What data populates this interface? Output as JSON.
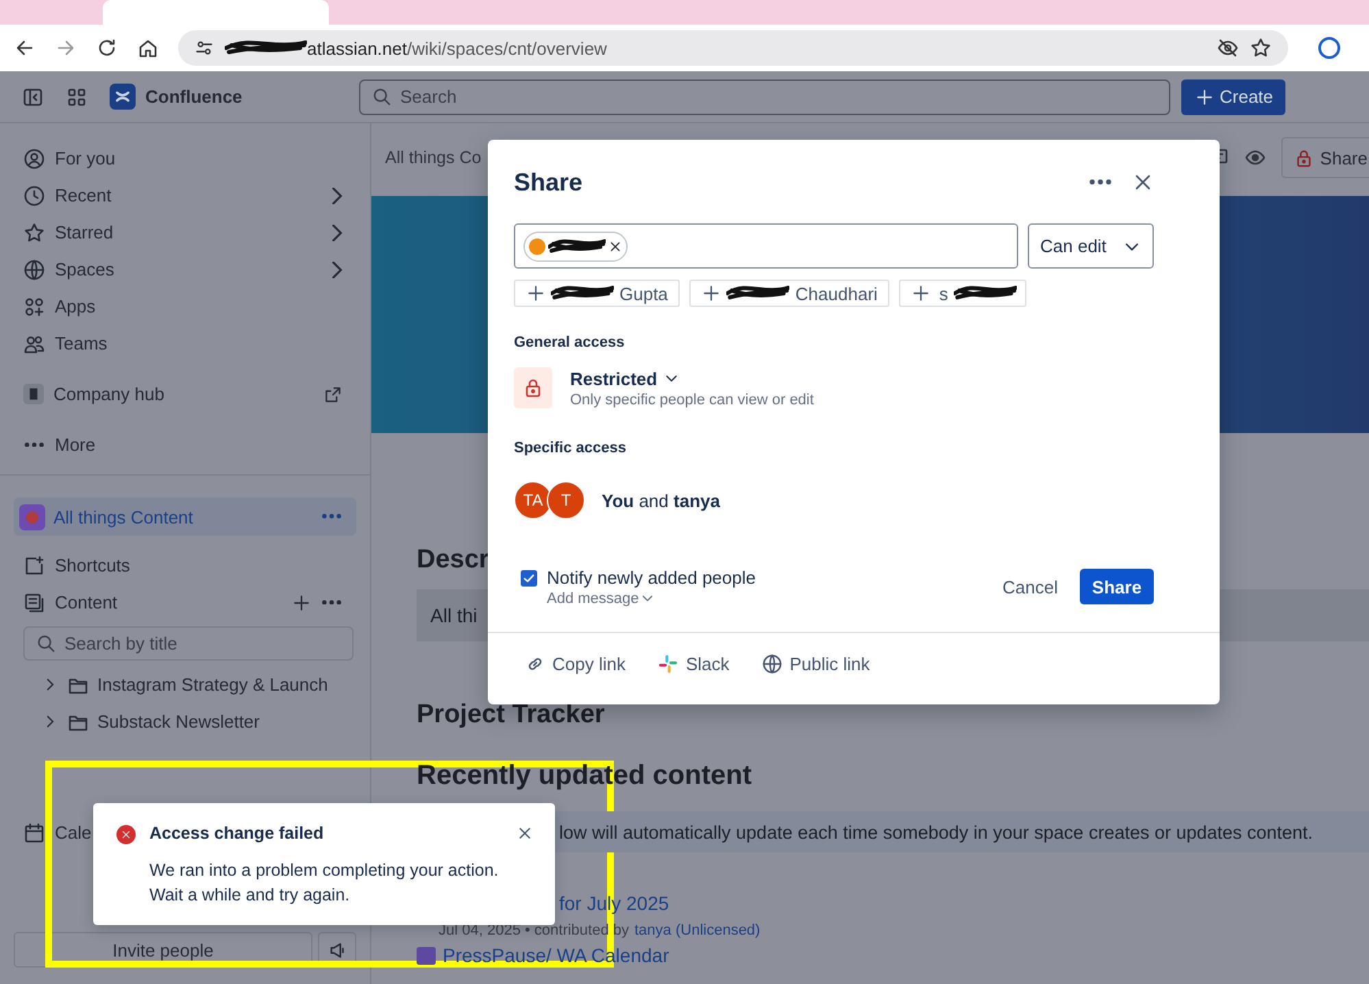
{
  "browser": {
    "url_host": "atlassian.net",
    "url_path": "/wiki/spaces/cnt/overview"
  },
  "header": {
    "product": "Confluence",
    "search_placeholder": "Search",
    "create_button": "Create"
  },
  "sidebar": {
    "nav": [
      {
        "label": "For you",
        "has_submenu": false
      },
      {
        "label": "Recent",
        "has_submenu": true
      },
      {
        "label": "Starred",
        "has_submenu": true
      },
      {
        "label": "Spaces",
        "has_submenu": true
      },
      {
        "label": "Apps",
        "has_submenu": false
      },
      {
        "label": "Teams",
        "has_submenu": false
      }
    ],
    "company_hub": "Company hub",
    "more": "More",
    "space": {
      "label": "All things Content",
      "selected": true
    },
    "shortcuts": "Shortcuts",
    "content": "Content",
    "search_placeholder": "Search by title",
    "tree": [
      {
        "label": "Instagram Strategy & Launch",
        "expanded": false
      },
      {
        "label": "Substack Newsletter",
        "expanded": false
      }
    ],
    "calendar": "Cale",
    "invite_button": "Invite people"
  },
  "page": {
    "breadcrumb": "All things Co",
    "share_button": "Share",
    "description_heading": "Descr",
    "description_text": "All thi",
    "tracker_heading": "Project Tracker",
    "recent_heading": "Recently updated content",
    "recent_info": "low will automatically update each time somebody in your space creates or updates content.",
    "recent_items": [
      {
        "title": "for July 2025",
        "meta": "Jul 04, 2025 • contributed by",
        "author": "tanya (Unlicensed)"
      },
      {
        "title": "PressPause/ WA Calendar"
      }
    ]
  },
  "share_dialog": {
    "title": "Share",
    "permission": "Can edit",
    "suggestions": [
      {
        "name": "Gupta"
      },
      {
        "name": "Chaudhari"
      },
      {
        "name": "s"
      }
    ],
    "general_access": {
      "heading": "General access",
      "setting": "Restricted",
      "description": "Only specific people can view or edit"
    },
    "specific_access": {
      "heading": "Specific access",
      "avatars": [
        "TA",
        "T"
      ],
      "summary": "**You** and **tanya**"
    },
    "notify": {
      "label": "Notify newly added people",
      "checked": true,
      "add_message": "Add message"
    },
    "cancel_button": "Cancel",
    "share_button": "Share",
    "footer_links": [
      "Copy link",
      "Slack",
      "Public link"
    ]
  },
  "toast": {
    "title": "Access change failed",
    "message": "We ran into a problem completing your action.\nWait a while and try again."
  }
}
